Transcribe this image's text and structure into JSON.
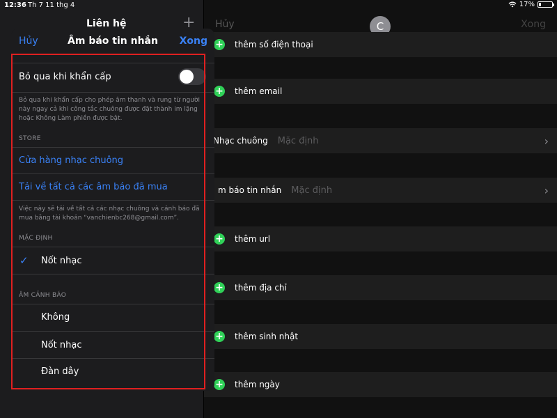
{
  "status": {
    "time": "12:36",
    "date": "Th 7 11 thg 4",
    "battery": "17%",
    "battery_fraction": 0.17
  },
  "left_panel": {
    "title": "Liên hệ",
    "add_icon": "plus-icon"
  },
  "right_panel": {
    "cancel": "Hủy",
    "done": "Xong",
    "avatar_letter": "C",
    "rows": {
      "phone": "thêm số điện thoại",
      "email": "thêm email",
      "ringtone_label": "Nhạc chuông",
      "ringtone_value": "Mặc định",
      "texttone_label": "m báo tin nhắn",
      "texttone_value": "Mặc định",
      "url": "thêm url",
      "address": "thêm địa chỉ",
      "birthday": "thêm sinh nhật",
      "date": "thêm ngày"
    }
  },
  "popover": {
    "cancel": "Hủy",
    "title": "Âm báo tin nhắn",
    "done": "Xong",
    "emergency_label": "Bỏ qua khi khẩn cấp",
    "emergency_on": false,
    "emergency_note": "Bỏ qua khi khẩn cấp cho phép âm thanh và rung từ người này ngay cả khi công tắc chuông được đặt thành im lặng hoặc Không Làm phiền được bật.",
    "store_header": "STORE",
    "store_link": "Cửa hàng nhạc chuông",
    "download_link": "Tải về tất cả các âm báo đã mua",
    "download_note": "Việc này sẽ tải về tất cả các nhạc chuông và cảnh báo đã mua bằng tài khoản “vanchienbc268@gmail.com”.",
    "default_header": "MẶC ĐỊNH",
    "default_item": "Nốt nhạc",
    "alert_header": "ÂM CẢNH BÁO",
    "alert_items": [
      "Không",
      "Nốt nhạc",
      "Đàn dây"
    ]
  },
  "colors": {
    "accent": "#3a82f7",
    "add": "#30d158",
    "highlight_box": "#e02020"
  }
}
